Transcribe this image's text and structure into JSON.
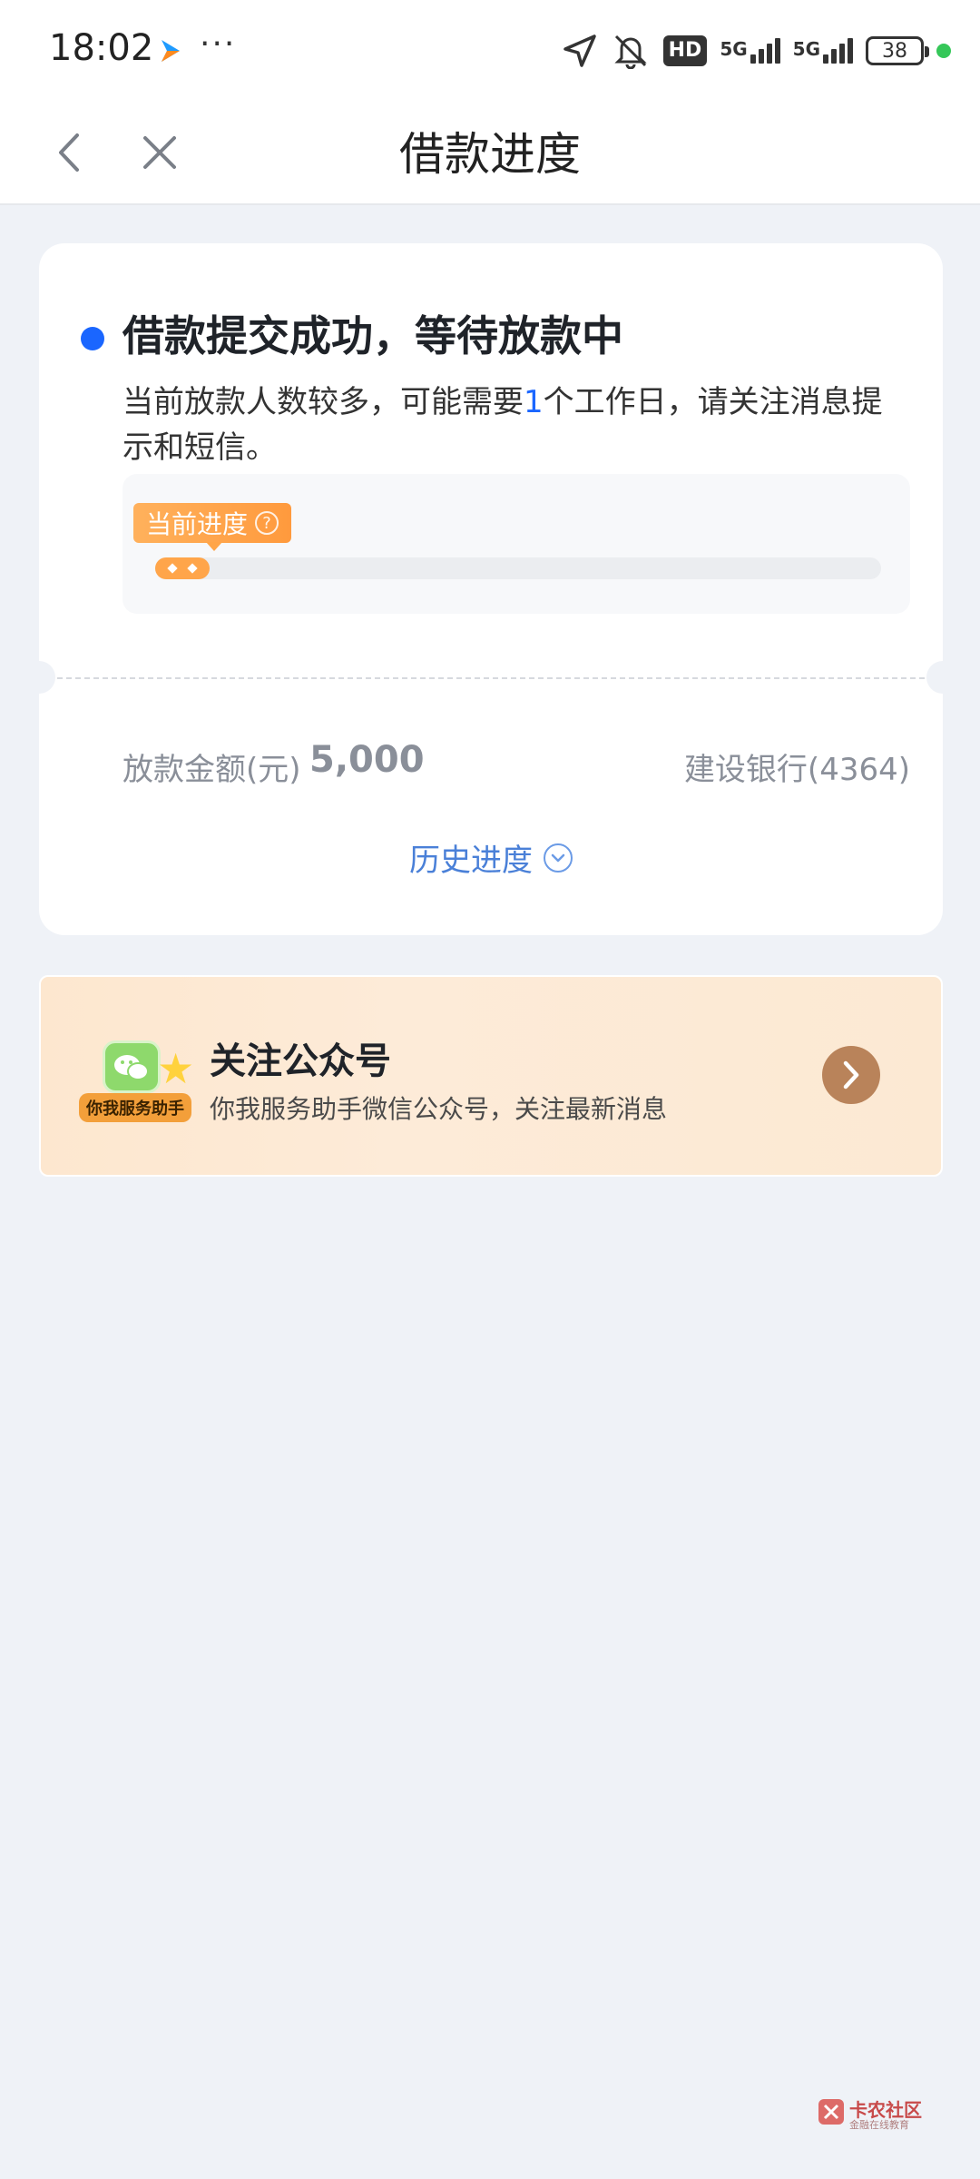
{
  "status_bar": {
    "time": "18:02",
    "dots": "···",
    "hd_label": "HD",
    "network_1": "5G",
    "network_2": "5G",
    "battery": "38"
  },
  "nav": {
    "title": "借款进度"
  },
  "progress_card": {
    "title": "借款提交成功，等待放款中",
    "desc_before": "当前放款人数较多，可能需要",
    "desc_highlight": "1",
    "desc_after": "个工作日，请关注消息提示和短信。",
    "progress_tag": "当前进度",
    "help_icon": "?",
    "progress_fraction": 0.05,
    "amount_label": "放款金额(元)",
    "amount_value": "5,000",
    "bank": "建设银行(4364)",
    "history_label": "历史进度"
  },
  "follow_card": {
    "badge": "你我服务助手",
    "title": "关注公众号",
    "subtitle": "你我服务助手微信公众号，关注最新消息"
  },
  "watermark": {
    "title": "卡农社区",
    "subtitle": "金融在线教育"
  },
  "colors": {
    "accent_blue": "#1a66ff",
    "progress_orange": "#ffa54a",
    "follow_arrow": "#b9835a"
  }
}
